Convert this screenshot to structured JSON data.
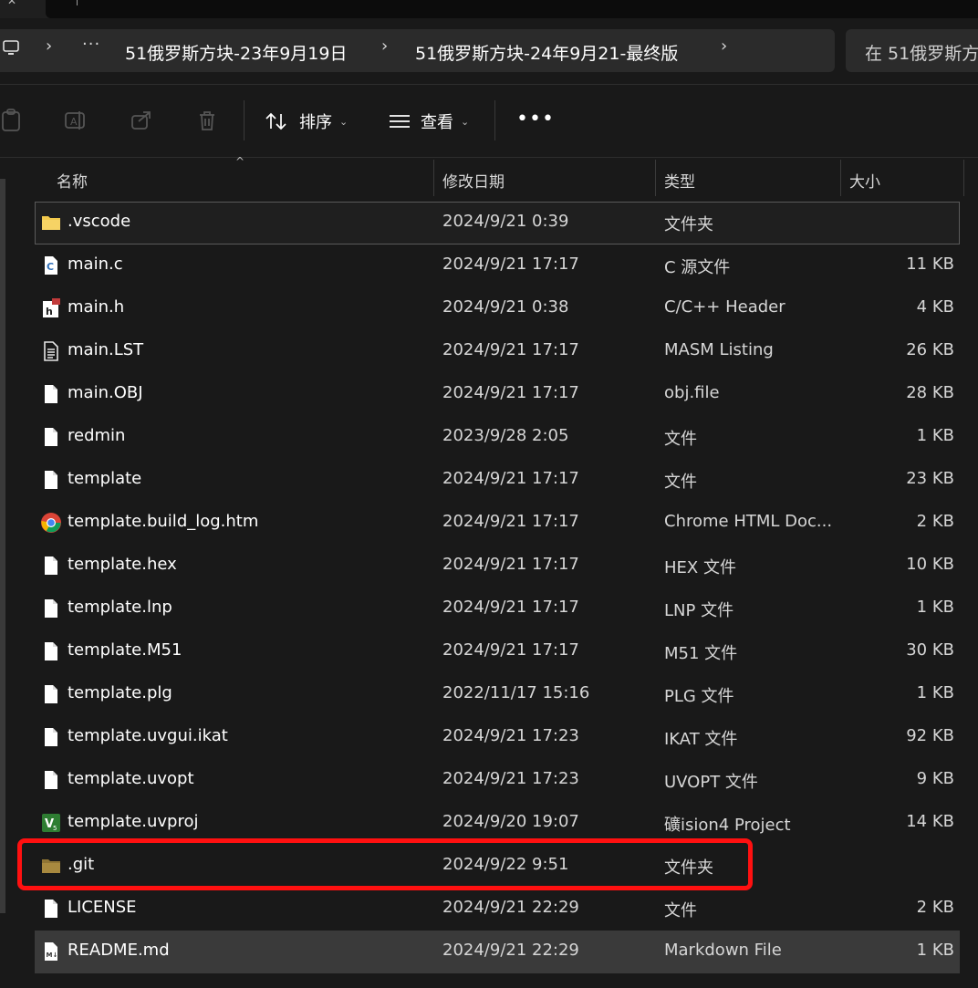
{
  "address": {
    "overflow": "···",
    "crumbs": [
      "51俄罗斯方块-23年9月19日",
      "51俄罗斯方块-24年9月21-最终版"
    ],
    "search_placeholder": "在 51俄罗斯方"
  },
  "toolbar": {
    "sort_label": "排序",
    "view_label": "查看",
    "more_label": "•••"
  },
  "columns": {
    "name": "名称",
    "date": "修改日期",
    "type": "类型",
    "size": "大小"
  },
  "files": [
    {
      "name": ".vscode",
      "date": "2024/9/21 0:39",
      "type": "文件夹",
      "size": "",
      "icon": "folder-icon"
    },
    {
      "name": "main.c",
      "date": "2024/9/21 17:17",
      "type": "C 源文件",
      "size": "11 KB",
      "icon": "c-file-icon"
    },
    {
      "name": "main.h",
      "date": "2024/9/21 0:38",
      "type": "C/C++ Header",
      "size": "4 KB",
      "icon": "header-file-icon"
    },
    {
      "name": "main.LST",
      "date": "2024/9/21 17:17",
      "type": "MASM Listing",
      "size": "26 KB",
      "icon": "text-file-icon"
    },
    {
      "name": "main.OBJ",
      "date": "2024/9/21 17:17",
      "type": "obj.file",
      "size": "28 KB",
      "icon": "file-icon"
    },
    {
      "name": "redmin",
      "date": "2023/9/28 2:05",
      "type": "文件",
      "size": "1 KB",
      "icon": "file-icon"
    },
    {
      "name": "template",
      "date": "2024/9/21 17:17",
      "type": "文件",
      "size": "23 KB",
      "icon": "file-icon"
    },
    {
      "name": "template.build_log.htm",
      "date": "2024/9/21 17:17",
      "type": "Chrome HTML Doc...",
      "size": "2 KB",
      "icon": "chrome-icon"
    },
    {
      "name": "template.hex",
      "date": "2024/9/21 17:17",
      "type": "HEX 文件",
      "size": "10 KB",
      "icon": "file-icon"
    },
    {
      "name": "template.lnp",
      "date": "2024/9/21 17:17",
      "type": "LNP 文件",
      "size": "1 KB",
      "icon": "file-icon"
    },
    {
      "name": "template.M51",
      "date": "2024/9/21 17:17",
      "type": "M51 文件",
      "size": "30 KB",
      "icon": "file-icon"
    },
    {
      "name": "template.plg",
      "date": "2022/11/17 15:16",
      "type": "PLG 文件",
      "size": "1 KB",
      "icon": "file-icon"
    },
    {
      "name": "template.uvgui.ikat",
      "date": "2024/9/21 17:23",
      "type": "IKAT 文件",
      "size": "92 KB",
      "icon": "file-icon"
    },
    {
      "name": "template.uvopt",
      "date": "2024/9/21 17:23",
      "type": "UVOPT 文件",
      "size": "9 KB",
      "icon": "file-icon"
    },
    {
      "name": "template.uvproj",
      "date": "2024/9/20 19:07",
      "type": "礦ision4 Project",
      "size": "14 KB",
      "icon": "keil-project-icon"
    },
    {
      "name": ".git",
      "date": "2024/9/22 9:51",
      "type": "文件夹",
      "size": "",
      "icon": "folder-icon-dim"
    },
    {
      "name": "LICENSE",
      "date": "2024/9/21 22:29",
      "type": "文件",
      "size": "2 KB",
      "icon": "file-icon"
    },
    {
      "name": "README.md",
      "date": "2024/9/21 22:29",
      "type": "Markdown File",
      "size": "1 KB",
      "icon": "markdown-file-icon"
    }
  ],
  "colors": {
    "highlight": "#ff1010",
    "folder": "#f2c94c",
    "folder_dim": "#a8893f"
  }
}
